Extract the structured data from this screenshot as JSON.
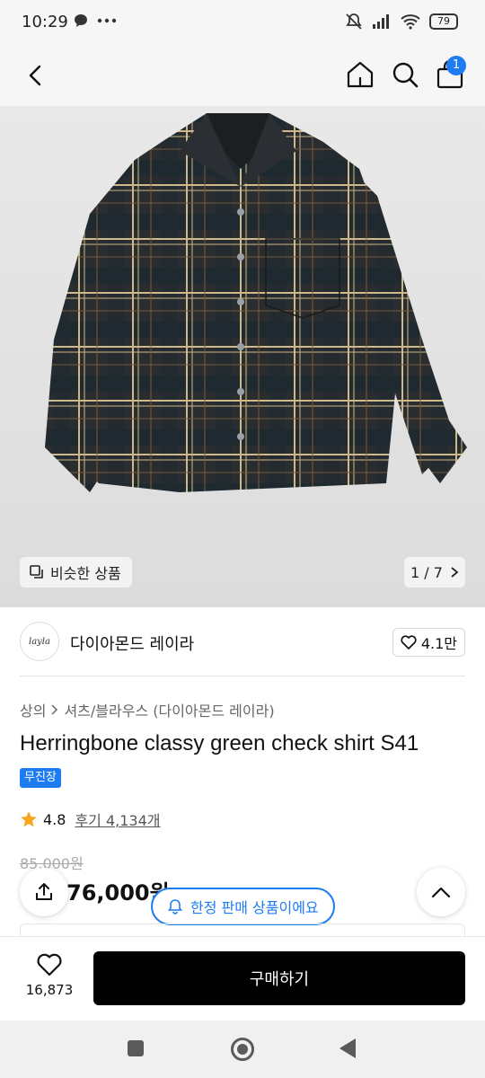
{
  "status": {
    "time": "10:29",
    "battery": "79"
  },
  "nav": {
    "cart_count": "1"
  },
  "gallery": {
    "similar_label": "비슷한 상품",
    "page_indicator": "1 / 7"
  },
  "brand": {
    "logo_text": "layla",
    "name": "다이아몬드 레이라",
    "likes": "4.1만"
  },
  "breadcrumb": {
    "category": "상의",
    "subcategory": "셔츠/블라우스 (다이아몬드 레이라)"
  },
  "product": {
    "title": "Herringbone classy green check shirt S41",
    "tag": "무진장",
    "rating": "4.8",
    "reviews": "후기 4,134개",
    "original_price": "85,000원",
    "price": "76,000원",
    "limited_label": "한정 판매 상품이에요"
  },
  "bottom": {
    "wish_count": "16,873",
    "buy_label": "구매하기"
  },
  "colors": {
    "accent": "#1e7cf2",
    "star": "#f6a623",
    "buy": "#000000"
  }
}
